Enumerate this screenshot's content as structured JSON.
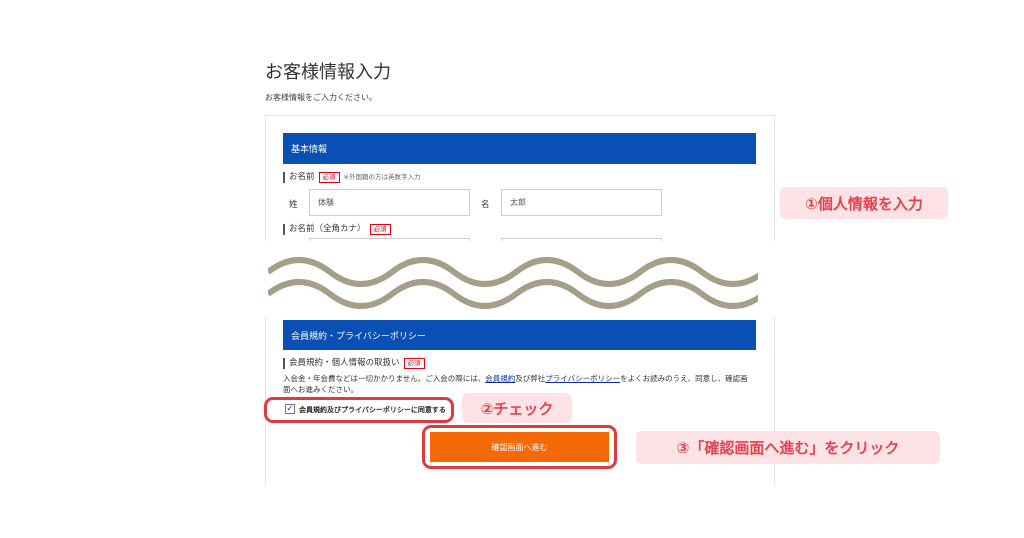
{
  "page": {
    "title": "お客様情報入力",
    "description": "お客様情報をご入力ください。"
  },
  "basic_info": {
    "section_title": "基本情報",
    "name_label": "お名前",
    "name_required": "必須",
    "name_note": "※外国籍の方は英数字入力",
    "last_name_label": "姓",
    "last_name_value": "体験",
    "first_name_label": "名",
    "first_name_value": "太郎",
    "kana_label": "お名前（全角カナ）",
    "kana_required": "必須"
  },
  "terms": {
    "section_title": "会員規約・プライバシーポリシー",
    "label": "会員規約・個人情報の取扱い",
    "required": "必須",
    "text_before": "入会金・年会費などは一切かかりません。ご入会の際には、",
    "link1": "会員規約",
    "text_mid": "及び弊社",
    "link2": "プライバシーポリシー",
    "text_after": "をよくお読みのうえ、同意し、確認画面へお進みください。",
    "checkbox_label": "会員規約及びプライバシーポリシーに同意する",
    "checkbox_checked": true,
    "checkmark": "✓"
  },
  "confirm_button_label": "確認画面へ進む",
  "callouts": {
    "step1": "①個人情報を入力",
    "step2": "②チェック",
    "step3": "③「確認画面へ進む」をクリック"
  },
  "colors": {
    "section_bar": "#0a4fb4",
    "button": "#f46a08",
    "highlight": "#e03a3e",
    "callout_bg": "#fde3e5",
    "callout_text": "#e5424d",
    "wave": "#a59f8a"
  }
}
